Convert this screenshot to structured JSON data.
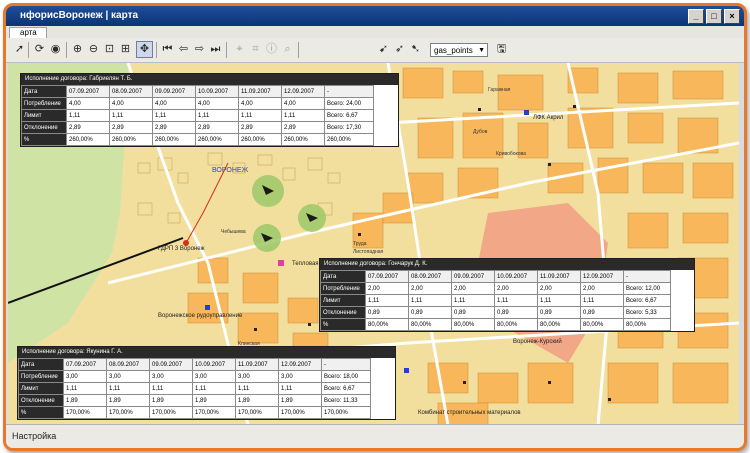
{
  "window": {
    "title": "нфорисВоронеж | карта",
    "min": "_",
    "max": "□",
    "close": "×"
  },
  "tab": {
    "label": "арта"
  },
  "toolbar": {
    "layer_select": "gas_points",
    "icons": [
      "select-arrow-icon",
      "refresh-icon",
      "globe-icon",
      "zoom-in-icon",
      "zoom-out-icon",
      "zoom-box-icon",
      "zoom-extent-icon",
      "pan-icon",
      "first-icon",
      "back-icon",
      "forward-icon",
      "last-icon",
      "measure-icon",
      "measure-area-icon",
      "info-icon",
      "find-icon",
      "pointer-add-icon",
      "pointer-move-icon",
      "pointer-delete-icon",
      "save-icon"
    ]
  },
  "status": {
    "text": "Настройка"
  },
  "map": {
    "labels": {
      "voronezh": "ВОРОНЕЖ",
      "gdrp": "ГДРП 3 Воронеж",
      "teplovaya": "Тепловая",
      "vrz": "Воронежское рудоуправление",
      "lfk": "ЛФК Акрил",
      "kombinat": "Комбинат строительных материалов",
      "vk": "Воронеж-Курский",
      "street1": "Чебышева",
      "street2": "Листопадная",
      "street3": "Труда",
      "street4": "Клинская",
      "street5": "Дубов",
      "street6": "Кривобокова",
      "street7": "Гаражная"
    },
    "colors": {
      "land": "#f3df9d",
      "block": "#f7b75a",
      "park": "#cfe3a5",
      "road": "#ffffff",
      "pink": "#f2a887",
      "marker": "#9cc96a"
    }
  },
  "panels": [
    {
      "title": "Исполнение договора: Габриелян Т. Б.",
      "rows": [
        {
          "label": "Дата",
          "cells": [
            "07.09.2007",
            "08.09.2007",
            "09.09.2007",
            "10.09.2007",
            "11.09.2007",
            "12.09.2007",
            "-"
          ]
        },
        {
          "label": "Потребление",
          "cells": [
            "4,00",
            "4,00",
            "4,00",
            "4,00",
            "4,00",
            "4,00",
            "Всего: 24,00"
          ]
        },
        {
          "label": "Лимит",
          "cells": [
            "1,11",
            "1,11",
            "1,11",
            "1,11",
            "1,11",
            "1,11",
            "Всего: 6,67"
          ]
        },
        {
          "label": "Отклонение",
          "cells": [
            "2,89",
            "2,89",
            "2,89",
            "2,89",
            "2,89",
            "2,89",
            "Всего: 17,30"
          ]
        },
        {
          "label": "%",
          "cells": [
            "260,00%",
            "260,00%",
            "260,00%",
            "260,00%",
            "260,00%",
            "260,00%",
            "260,00%"
          ]
        }
      ]
    },
    {
      "title": "Исполнение договора: Гончарук Д. К.",
      "rows": [
        {
          "label": "Дата",
          "cells": [
            "07.09.2007",
            "08.09.2007",
            "09.09.2007",
            "10.09.2007",
            "11.09.2007",
            "12.09.2007",
            "-"
          ]
        },
        {
          "label": "Потребление",
          "cells": [
            "2,00",
            "2,00",
            "2,00",
            "2,00",
            "2,00",
            "2,00",
            "Всего: 12,00"
          ]
        },
        {
          "label": "Лимит",
          "cells": [
            "1,11",
            "1,11",
            "1,11",
            "1,11",
            "1,11",
            "1,11",
            "Всего: 6,67"
          ]
        },
        {
          "label": "Отклонение",
          "cells": [
            "0,89",
            "0,89",
            "0,89",
            "0,89",
            "0,89",
            "0,89",
            "Всего: 5,33"
          ]
        },
        {
          "label": "%",
          "cells": [
            "80,00%",
            "80,00%",
            "80,00%",
            "80,00%",
            "80,00%",
            "80,00%",
            "80,00%"
          ]
        }
      ]
    },
    {
      "title": "Исполнение договора: Якунина Г. А.",
      "rows": [
        {
          "label": "Дата",
          "cells": [
            "07.09.2007",
            "08.09.2007",
            "09.09.2007",
            "10.09.2007",
            "11.09.2007",
            "12.09.2007",
            "-"
          ]
        },
        {
          "label": "Потребление",
          "cells": [
            "3,00",
            "3,00",
            "3,00",
            "3,00",
            "3,00",
            "3,00",
            "Всего: 18,00"
          ]
        },
        {
          "label": "Лимит",
          "cells": [
            "1,11",
            "1,11",
            "1,11",
            "1,11",
            "1,11",
            "1,11",
            "Всего: 6,67"
          ]
        },
        {
          "label": "Отклонение",
          "cells": [
            "1,89",
            "1,89",
            "1,89",
            "1,89",
            "1,89",
            "1,89",
            "Всего: 11,33"
          ]
        },
        {
          "label": "%",
          "cells": [
            "170,00%",
            "170,00%",
            "170,00%",
            "170,00%",
            "170,00%",
            "170,00%",
            "170,00%"
          ]
        }
      ]
    }
  ]
}
